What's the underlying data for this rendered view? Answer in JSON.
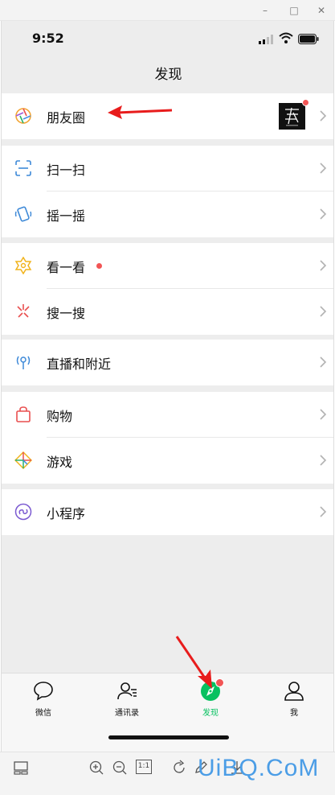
{
  "window": {
    "minimize": "–",
    "maximize": "□",
    "close": "✕"
  },
  "status_bar": {
    "time": "9:52"
  },
  "nav": {
    "title": "发现"
  },
  "colors": {
    "accent_green": "#07c160",
    "badge_red": "#f25555",
    "bg_gray": "#ededed"
  },
  "sections": [
    {
      "items": [
        {
          "label": "朋友圈",
          "icon": "moments-aperture-icon",
          "has_thumbnail": true
        }
      ]
    },
    {
      "items": [
        {
          "label": "扫一扫",
          "icon": "scan-icon"
        },
        {
          "label": "摇一摇",
          "icon": "shake-icon"
        }
      ]
    },
    {
      "items": [
        {
          "label": "看一看",
          "icon": "top-stories-icon",
          "badge": true
        },
        {
          "label": "搜一搜",
          "icon": "search-sparkle-icon"
        }
      ]
    },
    {
      "items": [
        {
          "label": "直播和附近",
          "icon": "live-nearby-icon"
        }
      ]
    },
    {
      "items": [
        {
          "label": "购物",
          "icon": "shopping-bag-icon"
        },
        {
          "label": "游戏",
          "icon": "game-diamond-icon"
        }
      ]
    },
    {
      "items": [
        {
          "label": "小程序",
          "icon": "mini-program-icon"
        }
      ]
    }
  ],
  "tabbar": {
    "tabs": [
      {
        "label": "微信",
        "icon": "chat-bubble-icon"
      },
      {
        "label": "通讯录",
        "icon": "contacts-icon"
      },
      {
        "label": "发现",
        "icon": "discover-compass-icon",
        "active": true
      },
      {
        "label": "我",
        "icon": "me-person-icon"
      }
    ]
  },
  "viewer_toolbar": {
    "icons": [
      "layout-icon",
      "zoom-in-icon",
      "zoom-out-icon",
      "actual-size-icon",
      "rotate-icon",
      "edit-pen-icon",
      "download-icon"
    ],
    "actual_size_label": "1:1"
  },
  "watermark": "UiBQ.CoM"
}
